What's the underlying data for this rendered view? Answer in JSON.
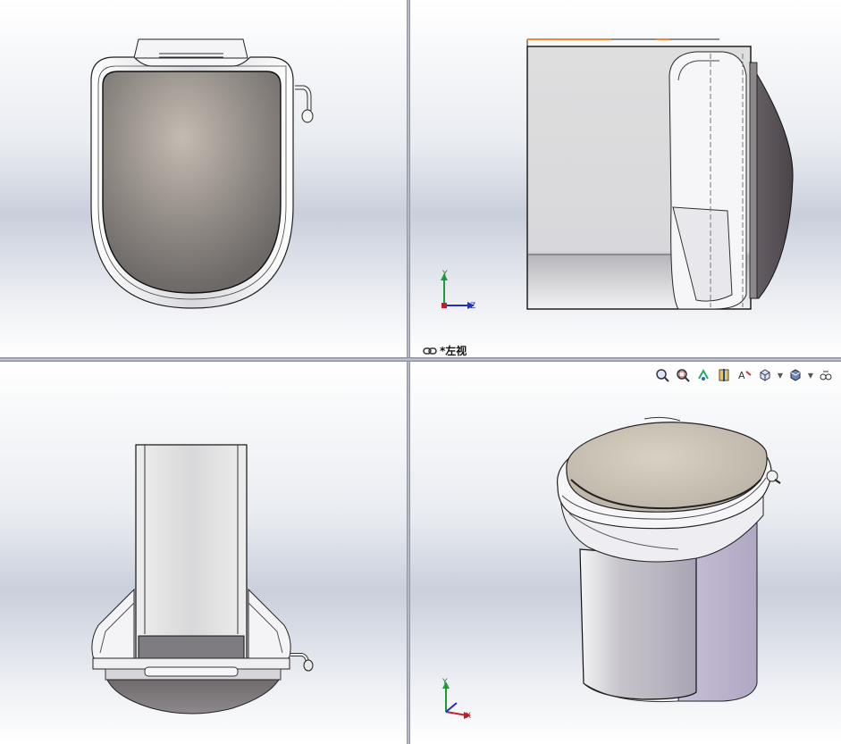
{
  "viewports": {
    "top_right": {
      "label": "*左视"
    }
  },
  "triad": {
    "front": {
      "x": "",
      "y": "Y",
      "z": "Z"
    },
    "iso": {
      "x": "X",
      "y": "Y",
      "z": ""
    }
  },
  "toolbar": {
    "icons": [
      "zoom-to-fit-icon",
      "zoom-to-area-icon",
      "previous-view-icon",
      "section-view-icon",
      "dynamic-annotation-icon",
      "view-orientation-icon",
      "display-style-icon",
      "hide-show-icon"
    ]
  },
  "colors": {
    "seat": "#8c8580",
    "body": "#e4e4e8",
    "background": "#dfe3ea",
    "triad_x": "#c0202a",
    "triad_y": "#1d9a3a",
    "triad_z": "#2030c0"
  }
}
